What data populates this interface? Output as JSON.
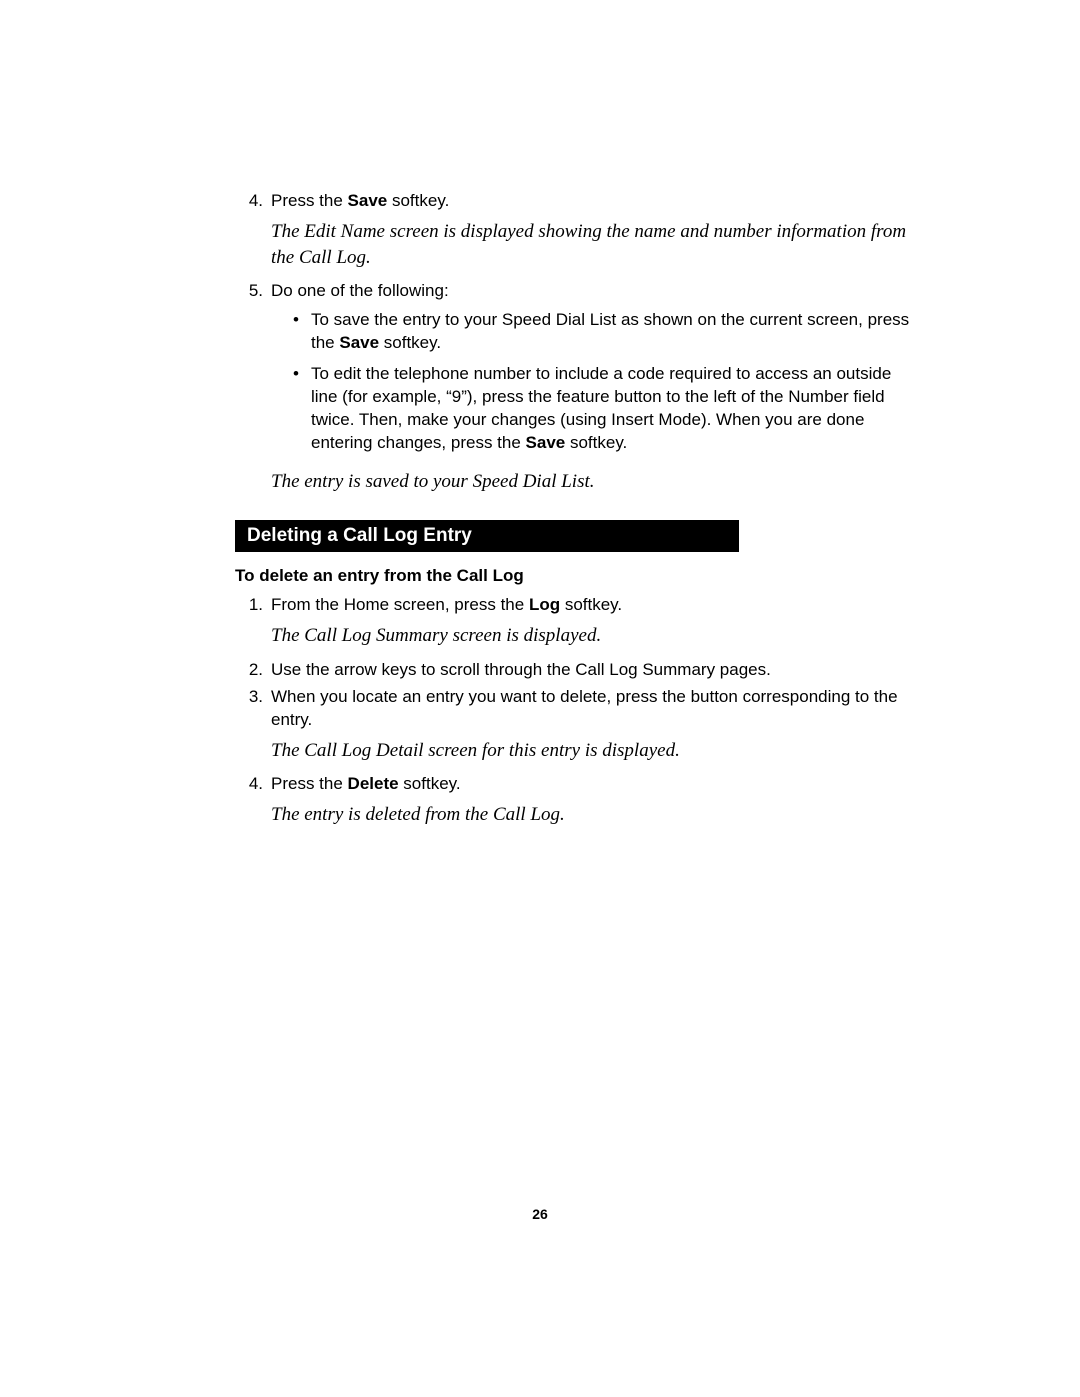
{
  "top": {
    "step4_num": "4.",
    "step4_a": "Press the ",
    "step4_bold": "Save",
    "step4_b": " softkey.",
    "note1": "The Edit Name screen is displayed showing the name and number information from the Call Log.",
    "step5_num": "5.",
    "step5_text": "Do one of the following:",
    "bullet1_a": "To save the entry to your Speed Dial List as shown on the current screen, press the ",
    "bullet1_bold": "Save",
    "bullet1_b": " softkey.",
    "bullet2_a": "To edit the telephone number to include a code required to access an outside line (for example, “9”), press the feature button to the left of the Number field twice. Then, make your changes (using Insert Mode). When you are done entering changes, press the ",
    "bullet2_bold": "Save",
    "bullet2_b": " softkey.",
    "note2": "The entry is saved to your Speed Dial List."
  },
  "section": {
    "heading": "Deleting a Call Log Entry",
    "sub": "To delete an entry from the Call Log",
    "s1_num": "1.",
    "s1_a": "From the Home screen, press the ",
    "s1_bold": "Log",
    "s1_b": " softkey.",
    "note1": "The Call Log Summary screen is displayed.",
    "s2_num": "2.",
    "s2": "Use the arrow keys to scroll through the Call Log Summary pages.",
    "s3_num": "3.",
    "s3": "When you locate an entry you want to delete, press the button corresponding to the entry.",
    "note2": "The Call Log Detail screen for this entry is displayed.",
    "s4_num": "4.",
    "s4_a": "Press the ",
    "s4_bold": "Delete",
    "s4_b": " softkey.",
    "note3": "The entry is deleted from the Call Log."
  },
  "page_number": "26"
}
